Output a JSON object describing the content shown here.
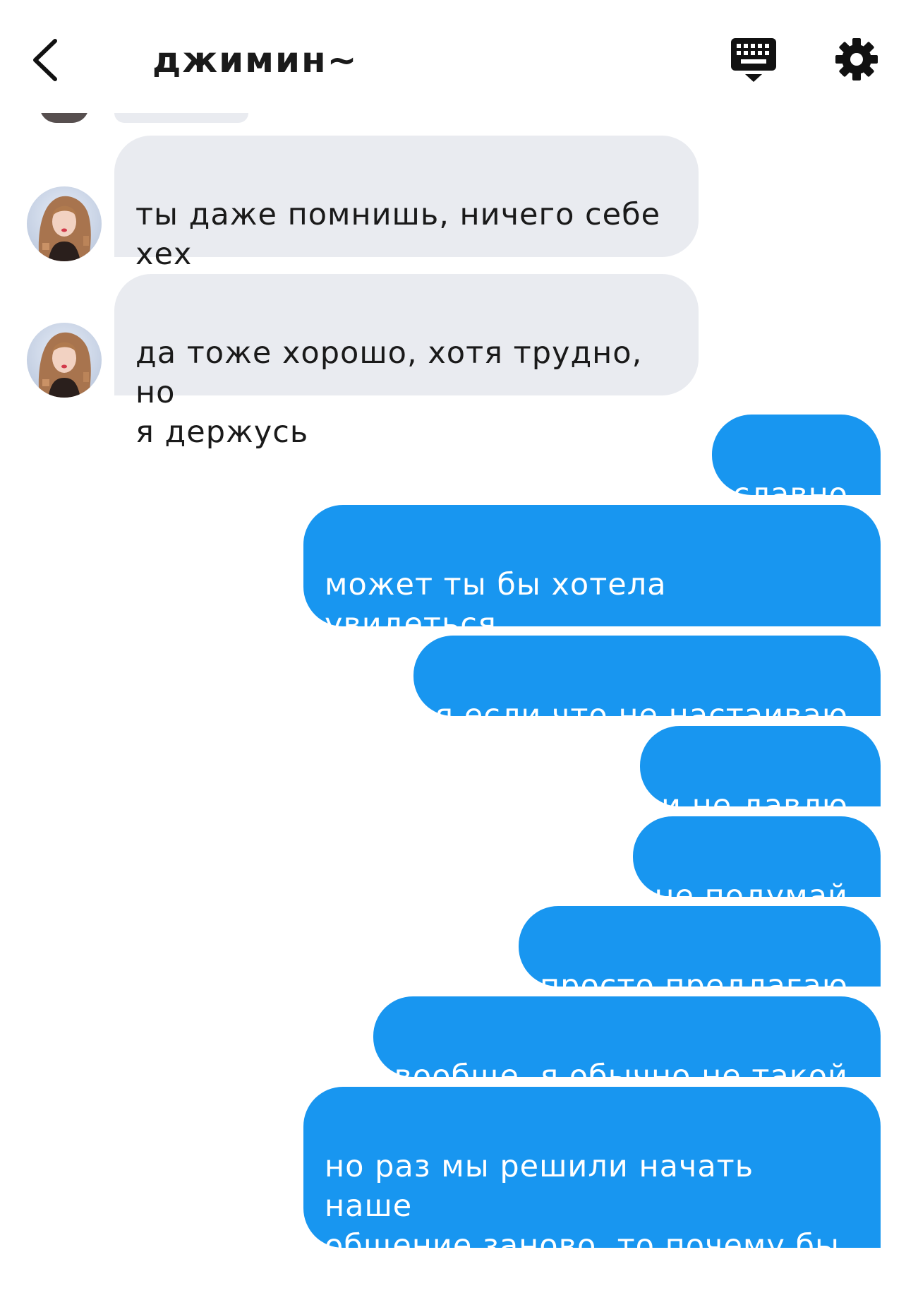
{
  "header": {
    "title": "джимин~",
    "back_icon": "chevron-left-icon",
    "keyboard_icon": "keyboard-icon",
    "settings_icon": "gear-icon"
  },
  "colors": {
    "outgoing_bubble": "#1896f0",
    "incoming_bubble": "#e9ebf0",
    "header_text": "#1a1a1a"
  },
  "messages": {
    "incoming": [
      "ты даже помнишь, ничего себе\nхех",
      "да тоже хорошо, хотя трудно, но\nя держусь"
    ],
    "outgoing": [
      "славно",
      "может ты бы хотела увидеться\nсегодня тоже?",
      "я если что не настаиваю",
      "и не давлю",
      "не подумай",
      "просто предлагаю",
      "вообще, я обычно не такой",
      "но раз мы решили начать наше\nобщение заново, то почему бы\nне предложить"
    ]
  }
}
